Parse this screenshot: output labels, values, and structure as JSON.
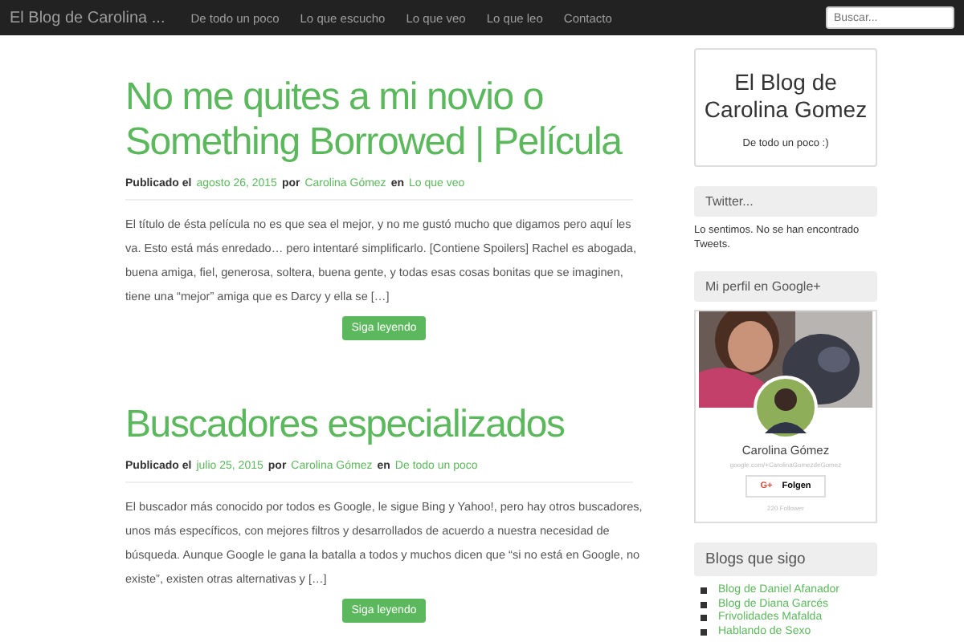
{
  "navbar": {
    "brand": "El Blog de Carolina ...",
    "links": [
      "De todo un poco",
      "Lo que escucho",
      "Lo que veo",
      "Lo que leo",
      "Contacto"
    ],
    "search": {
      "placeholder": "Buscar..."
    }
  },
  "posts": [
    {
      "title": "No me quites a mi novio o Something Borrowed | Película",
      "meta": {
        "prefix": "Publicado el",
        "date": "agosto 26, 2015",
        "by": "por",
        "author": "Carolina Gómez",
        "in": "en",
        "category": "Lo que veo"
      },
      "excerpt": "El título de ésta película no es que sea el mejor, y no me gustó mucho que digamos pero aquí les va. Esto está más enredado… pero intentaré simplificarlo. [Contiene Spoilers] Rachel es abogada, buena amiga, fiel, generosa, soltera, buena gente, y todas esas cosas bonitas que se imaginen, tiene una “mejor” amiga que es Darcy y ella se […]",
      "button": "Siga leyendo"
    },
    {
      "title": "Buscadores especializados",
      "meta": {
        "prefix": "Publicado el",
        "date": "julio 25, 2015",
        "by": "por",
        "author": "Carolina Gómez",
        "in": "en",
        "category": "De todo un poco"
      },
      "excerpt": "El buscador más conocido por todos es Google, le sigue Bing y Yahoo!, pero hay otros buscadores, unos más específicos, con mejores filtros y desarrollados de acuerdo a nuestra necesidad de búsqueda. Aunque Google le gana la batalla a todos y muchos dicen que “si no está en Google, no existe”, existen otras alternativas y […]",
      "button": "Siga leyendo"
    }
  ],
  "sidebar": {
    "blog_card": {
      "title": "El Blog de Carolina Gomez",
      "tagline": "De todo un poco :)"
    },
    "twitter": {
      "heading": "Twitter...",
      "message": "Lo sentimos. No se han encontrado Tweets."
    },
    "google_profile": {
      "heading": "Mi perfil en Google+",
      "name": "Carolina Gómez",
      "url": "google.com/+CarolinaGomezdeGomez",
      "button": "Folgen",
      "button_icon": "G+",
      "followers": "220 Follower"
    },
    "blogs": {
      "heading": "Blogs que sigo",
      "items": [
        "Blog de Daniel Afanador",
        "Blog de Diana Garcés",
        "Frivolidades Mafalda",
        "Hablando de Sexo"
      ]
    }
  }
}
